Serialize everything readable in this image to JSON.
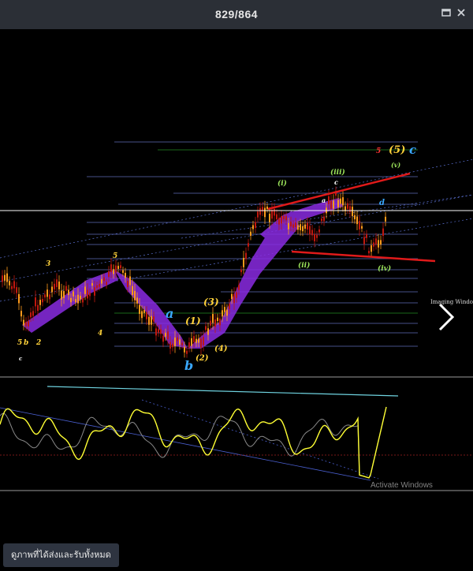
{
  "window": {
    "title": "829/864",
    "maximize_icon": "restore-icon",
    "close_icon": "close-icon"
  },
  "viewer": {
    "next_icon": "chevron-right-icon",
    "watermark": "Activate Windows",
    "side_label": "Imaging Window"
  },
  "footer": {
    "view_all_label": "ดูภาพที่ได้ส่งและรับทั้งหมด"
  },
  "colors": {
    "background": "#000000",
    "price_line": "#ffffff",
    "wave_band": "#8a2be2",
    "trend_red": "#e01a1a",
    "oscillator": "#ffff33",
    "osc_line_cyan": "#6fd3e0",
    "fib_line": "#6f7fd8"
  },
  "wave_labels": [
    {
      "text": "5",
      "color": "#ffd23a"
    },
    {
      "text": "b",
      "color": "#ffd23a"
    },
    {
      "text": "2",
      "color": "#ffd23a"
    },
    {
      "text": "c",
      "color": "#ffffff"
    },
    {
      "text": "3",
      "color": "#ffd23a"
    },
    {
      "text": "4",
      "color": "#ffd23a"
    },
    {
      "text": "5",
      "color": "#ffd23a"
    },
    {
      "text": "a",
      "color": "#3aa8ff"
    },
    {
      "text": "b",
      "color": "#3aa8ff"
    },
    {
      "text": "(1)",
      "color": "#ffd23a"
    },
    {
      "text": "(2)",
      "color": "#ffd23a"
    },
    {
      "text": "(3)",
      "color": "#ffd23a"
    },
    {
      "text": "(4)",
      "color": "#ffd23a"
    },
    {
      "text": "(i)",
      "color": "#9be35a"
    },
    {
      "text": "(ii)",
      "color": "#9be35a"
    },
    {
      "text": "(iii)",
      "color": "#9be35a"
    },
    {
      "text": "(iv)",
      "color": "#9be35a"
    },
    {
      "text": "(v)",
      "color": "#9be35a"
    },
    {
      "text": "(5)",
      "color": "#ffd23a"
    },
    {
      "text": "c",
      "color": "#3aa8ff"
    },
    {
      "text": "5",
      "color": "#ff3333"
    },
    {
      "text": "d",
      "color": "#3aa8ff"
    },
    {
      "text": "c",
      "color": "#ffffff"
    },
    {
      "text": "a",
      "color": "#ffffff"
    }
  ]
}
